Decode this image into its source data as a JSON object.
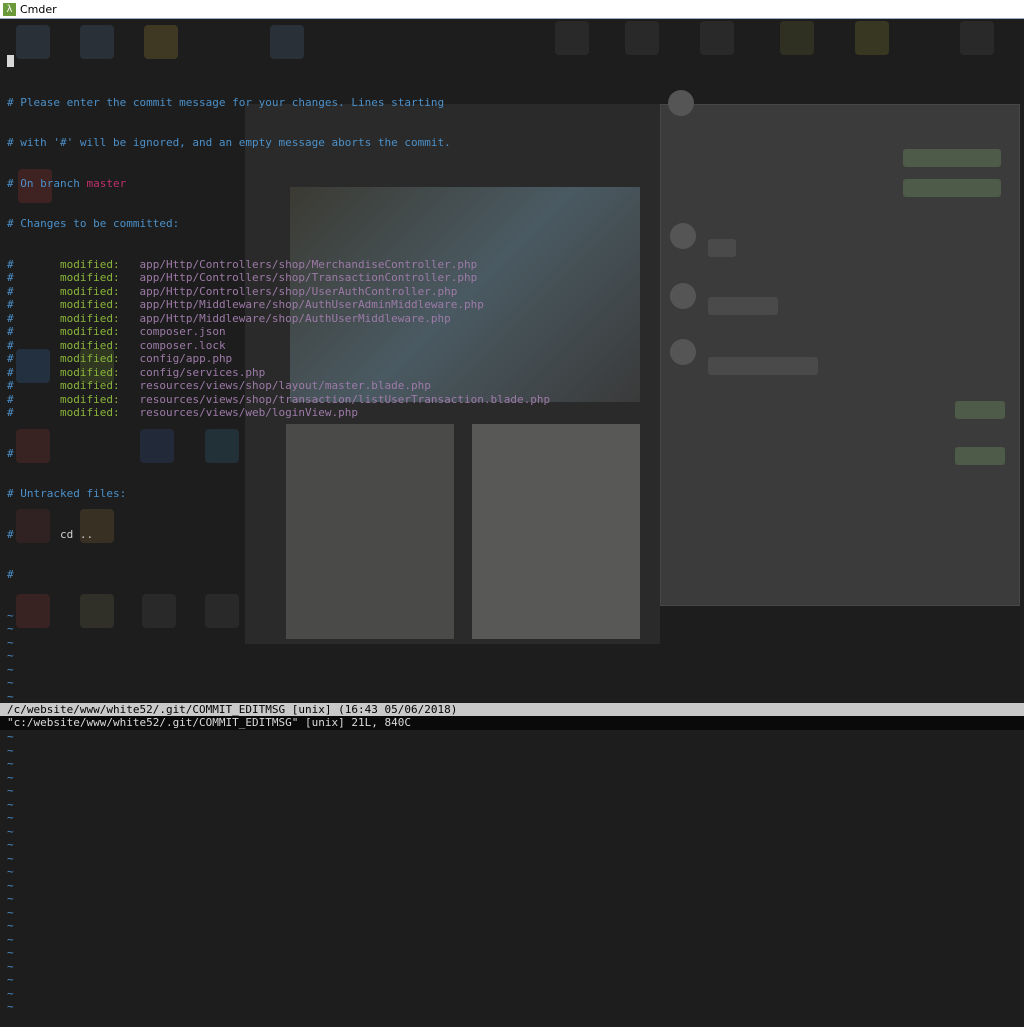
{
  "window": {
    "title": "Cmder",
    "icon": "lambda-icon"
  },
  "editor": {
    "comments": [
      "# Please enter the commit message for your changes. Lines starting",
      "# with '#' will be ignored, and an empty message aborts the commit."
    ],
    "branch_prefix": "# On branch ",
    "branch": "master",
    "hash": "#",
    "changes_header": "# Changes to be committed:",
    "modified_label": "modified:",
    "modified_files": [
      "app/Http/Controllers/shop/MerchandiseController.php",
      "app/Http/Controllers/shop/TransactionController.php",
      "app/Http/Controllers/shop/UserAuthController.php",
      "app/Http/Middleware/shop/AuthUserAdminMiddleware.php",
      "app/Http/Middleware/shop/AuthUserMiddleware.php",
      "composer.json",
      "composer.lock",
      "config/app.php",
      "config/services.php",
      "resources/views/shop/layout/master.blade.php",
      "resources/views/shop/transaction/listUserTransaction.blade.php",
      "resources/views/web/loginView.php"
    ],
    "untracked_header": "# Untracked files:",
    "untracked_files": [
      "cd .."
    ],
    "tilde": "~",
    "tilde_count": 30
  },
  "status_bar": "/c/website/www/white52/.git/COMMIT_EDITMSG [unix] (16:43 05/06/2018)",
  "message_line": "\"c:/website/www/white52/.git/COMMIT_EDITMSG\" [unix] 21L, 840C"
}
